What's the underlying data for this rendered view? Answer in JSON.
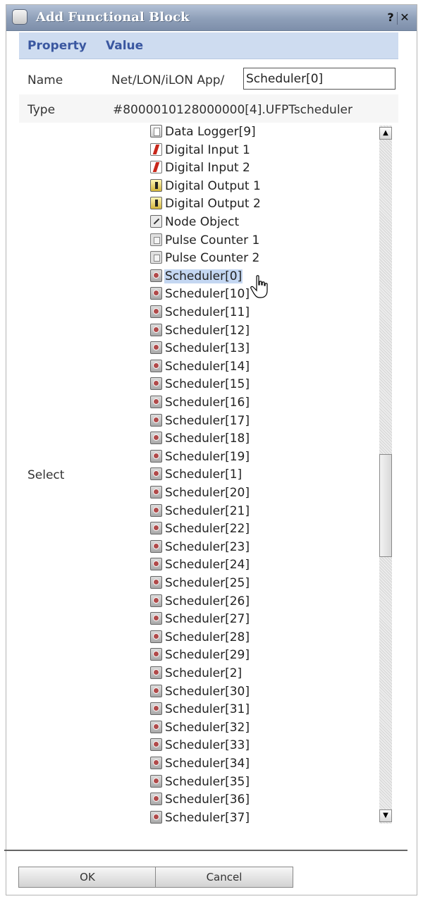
{
  "window": {
    "title": "Add Functional Block",
    "help_label": "?",
    "close_label": "✕"
  },
  "table": {
    "header_property": "Property",
    "header_value": "Value",
    "name_label": "Name",
    "name_prefix": "Net/LON/iLON App/",
    "name_input_value": "Scheduler[0]",
    "type_label": "Type",
    "type_value": "#8000010128000000[4].UFPTscheduler",
    "select_label": "Select"
  },
  "tree": {
    "items": [
      {
        "label": "Data Logger[9]",
        "icon": "data-logger-icon"
      },
      {
        "label": "Digital Input 1",
        "icon": "digital-input-icon"
      },
      {
        "label": "Digital Input 2",
        "icon": "digital-input-icon"
      },
      {
        "label": "Digital Output 1",
        "icon": "digital-output-icon"
      },
      {
        "label": "Digital Output 2",
        "icon": "digital-output-icon"
      },
      {
        "label": "Node Object",
        "icon": "node-object-icon"
      },
      {
        "label": "Pulse Counter 1",
        "icon": "pulse-counter-icon"
      },
      {
        "label": "Pulse Counter 2",
        "icon": "pulse-counter-icon"
      },
      {
        "label": "Scheduler[0]",
        "icon": "scheduler-icon",
        "selected": true
      },
      {
        "label": "Scheduler[10]",
        "icon": "scheduler-icon"
      },
      {
        "label": "Scheduler[11]",
        "icon": "scheduler-icon"
      },
      {
        "label": "Scheduler[12]",
        "icon": "scheduler-icon"
      },
      {
        "label": "Scheduler[13]",
        "icon": "scheduler-icon"
      },
      {
        "label": "Scheduler[14]",
        "icon": "scheduler-icon"
      },
      {
        "label": "Scheduler[15]",
        "icon": "scheduler-icon"
      },
      {
        "label": "Scheduler[16]",
        "icon": "scheduler-icon"
      },
      {
        "label": "Scheduler[17]",
        "icon": "scheduler-icon"
      },
      {
        "label": "Scheduler[18]",
        "icon": "scheduler-icon"
      },
      {
        "label": "Scheduler[19]",
        "icon": "scheduler-icon"
      },
      {
        "label": "Scheduler[1]",
        "icon": "scheduler-icon"
      },
      {
        "label": "Scheduler[20]",
        "icon": "scheduler-icon"
      },
      {
        "label": "Scheduler[21]",
        "icon": "scheduler-icon"
      },
      {
        "label": "Scheduler[22]",
        "icon": "scheduler-icon"
      },
      {
        "label": "Scheduler[23]",
        "icon": "scheduler-icon"
      },
      {
        "label": "Scheduler[24]",
        "icon": "scheduler-icon"
      },
      {
        "label": "Scheduler[25]",
        "icon": "scheduler-icon"
      },
      {
        "label": "Scheduler[26]",
        "icon": "scheduler-icon"
      },
      {
        "label": "Scheduler[27]",
        "icon": "scheduler-icon"
      },
      {
        "label": "Scheduler[28]",
        "icon": "scheduler-icon"
      },
      {
        "label": "Scheduler[29]",
        "icon": "scheduler-icon"
      },
      {
        "label": "Scheduler[2]",
        "icon": "scheduler-icon"
      },
      {
        "label": "Scheduler[30]",
        "icon": "scheduler-icon"
      },
      {
        "label": "Scheduler[31]",
        "icon": "scheduler-icon"
      },
      {
        "label": "Scheduler[32]",
        "icon": "scheduler-icon"
      },
      {
        "label": "Scheduler[33]",
        "icon": "scheduler-icon"
      },
      {
        "label": "Scheduler[34]",
        "icon": "scheduler-icon"
      },
      {
        "label": "Scheduler[35]",
        "icon": "scheduler-icon"
      },
      {
        "label": "Scheduler[36]",
        "icon": "scheduler-icon"
      },
      {
        "label": "Scheduler[37]",
        "icon": "scheduler-icon"
      }
    ]
  },
  "buttons": {
    "ok_label": "OK",
    "cancel_label": "Cancel"
  },
  "colors": {
    "header_bg": "#cedcf0",
    "header_text": "#3a57a0",
    "selection_bg": "#c4d7f2",
    "titlebar": "#8e9fb8"
  }
}
